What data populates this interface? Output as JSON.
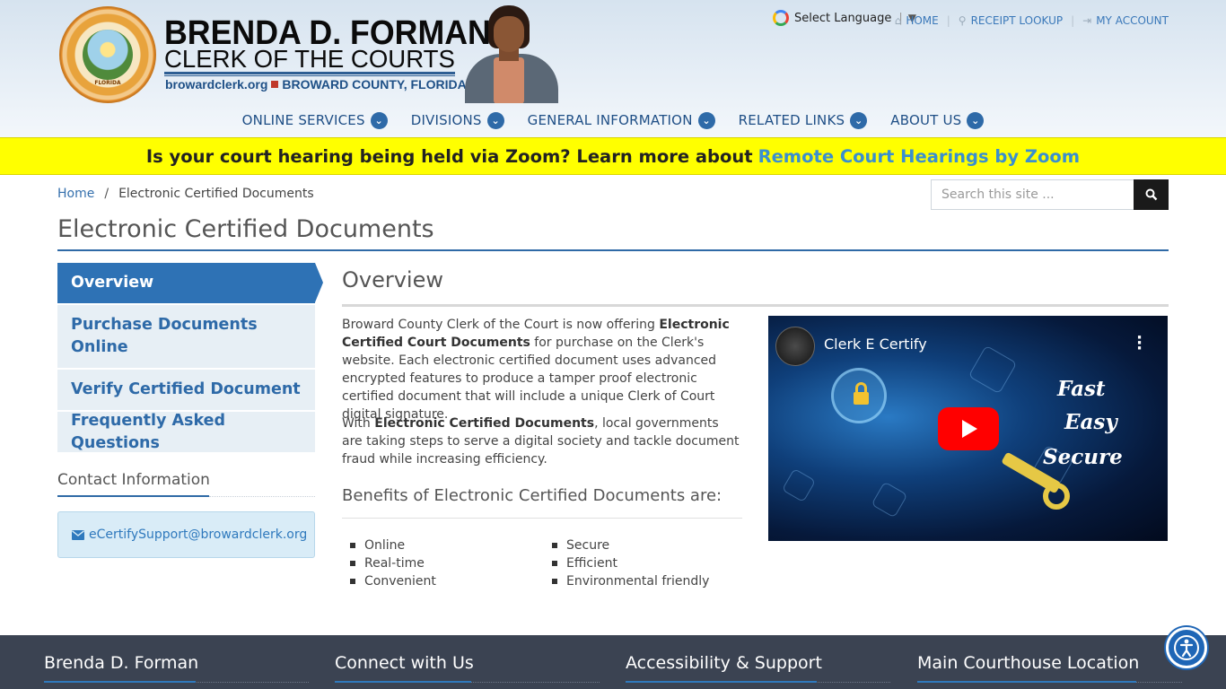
{
  "header": {
    "seal_text": "FLORIDA",
    "brand_name": "BRENDA D. FORMAN",
    "brand_title": "CLERK OF THE COURTS",
    "site": "browardclerk.org",
    "county": "BROWARD COUNTY, FLORIDA",
    "language_label": "Select Language",
    "top_links": [
      {
        "label": "HOME",
        "icon": "home-icon"
      },
      {
        "label": "RECEIPT LOOKUP",
        "icon": "search-icon"
      },
      {
        "label": "MY ACCOUNT",
        "icon": "sign-in-icon"
      }
    ],
    "nav": [
      {
        "label": "ONLINE SERVICES"
      },
      {
        "label": "DIVISIONS"
      },
      {
        "label": "GENERAL INFORMATION"
      },
      {
        "label": "RELATED LINKS"
      },
      {
        "label": "ABOUT US"
      }
    ]
  },
  "alert": {
    "text": "Is your court hearing being held via Zoom? Learn more about",
    "link": "Remote Court Hearings by Zoom"
  },
  "breadcrumb": {
    "home": "Home",
    "separator": "/",
    "current": "Electronic Certified Documents"
  },
  "search": {
    "placeholder": "Search this site ..."
  },
  "page_title": "Electronic Certified Documents",
  "sidebar": {
    "items": [
      {
        "label": "Overview",
        "active": true
      },
      {
        "label": "Purchase Documents Online"
      },
      {
        "label": "Verify Certified Document"
      },
      {
        "label": "Frequently Asked Questions"
      }
    ],
    "contact_heading": "Contact Information",
    "contact_email": "eCertifySupport@browardclerk.org"
  },
  "main": {
    "heading": "Overview",
    "p1_a": "Broward County Clerk of the Court is now offering ",
    "p1_b": "Electronic Certified Court Documents",
    "p1_c": " for purchase on the Clerk's website. Each electronic certified document uses advanced encrypted features to produce a tamper proof electronic certified document that will include a unique Clerk of Court digital signature.",
    "p2_a": "With ",
    "p2_b": "Electronic Certified Documents",
    "p2_c": ", local governments are taking steps to serve a digital society and tackle document fraud while increasing efficiency.",
    "benefits_heading": "Benefits of Electronic Certified Documents are:",
    "benefits_left": [
      "Online",
      "Real-time",
      "Convenient"
    ],
    "benefits_right": [
      "Secure",
      "Efficient",
      "Environmental friendly"
    ]
  },
  "video": {
    "title": "Clerk E Certify",
    "words": [
      "Fast",
      "Easy",
      "Secure"
    ]
  },
  "footer": {
    "columns": [
      "Brenda D. Forman",
      "Connect with Us",
      "Accessibility & Support",
      "Main Courthouse Location"
    ]
  },
  "colors": {
    "brand_blue": "#2e72b5",
    "alert_yellow": "#ffff00",
    "footer_bg": "#3b4352"
  }
}
